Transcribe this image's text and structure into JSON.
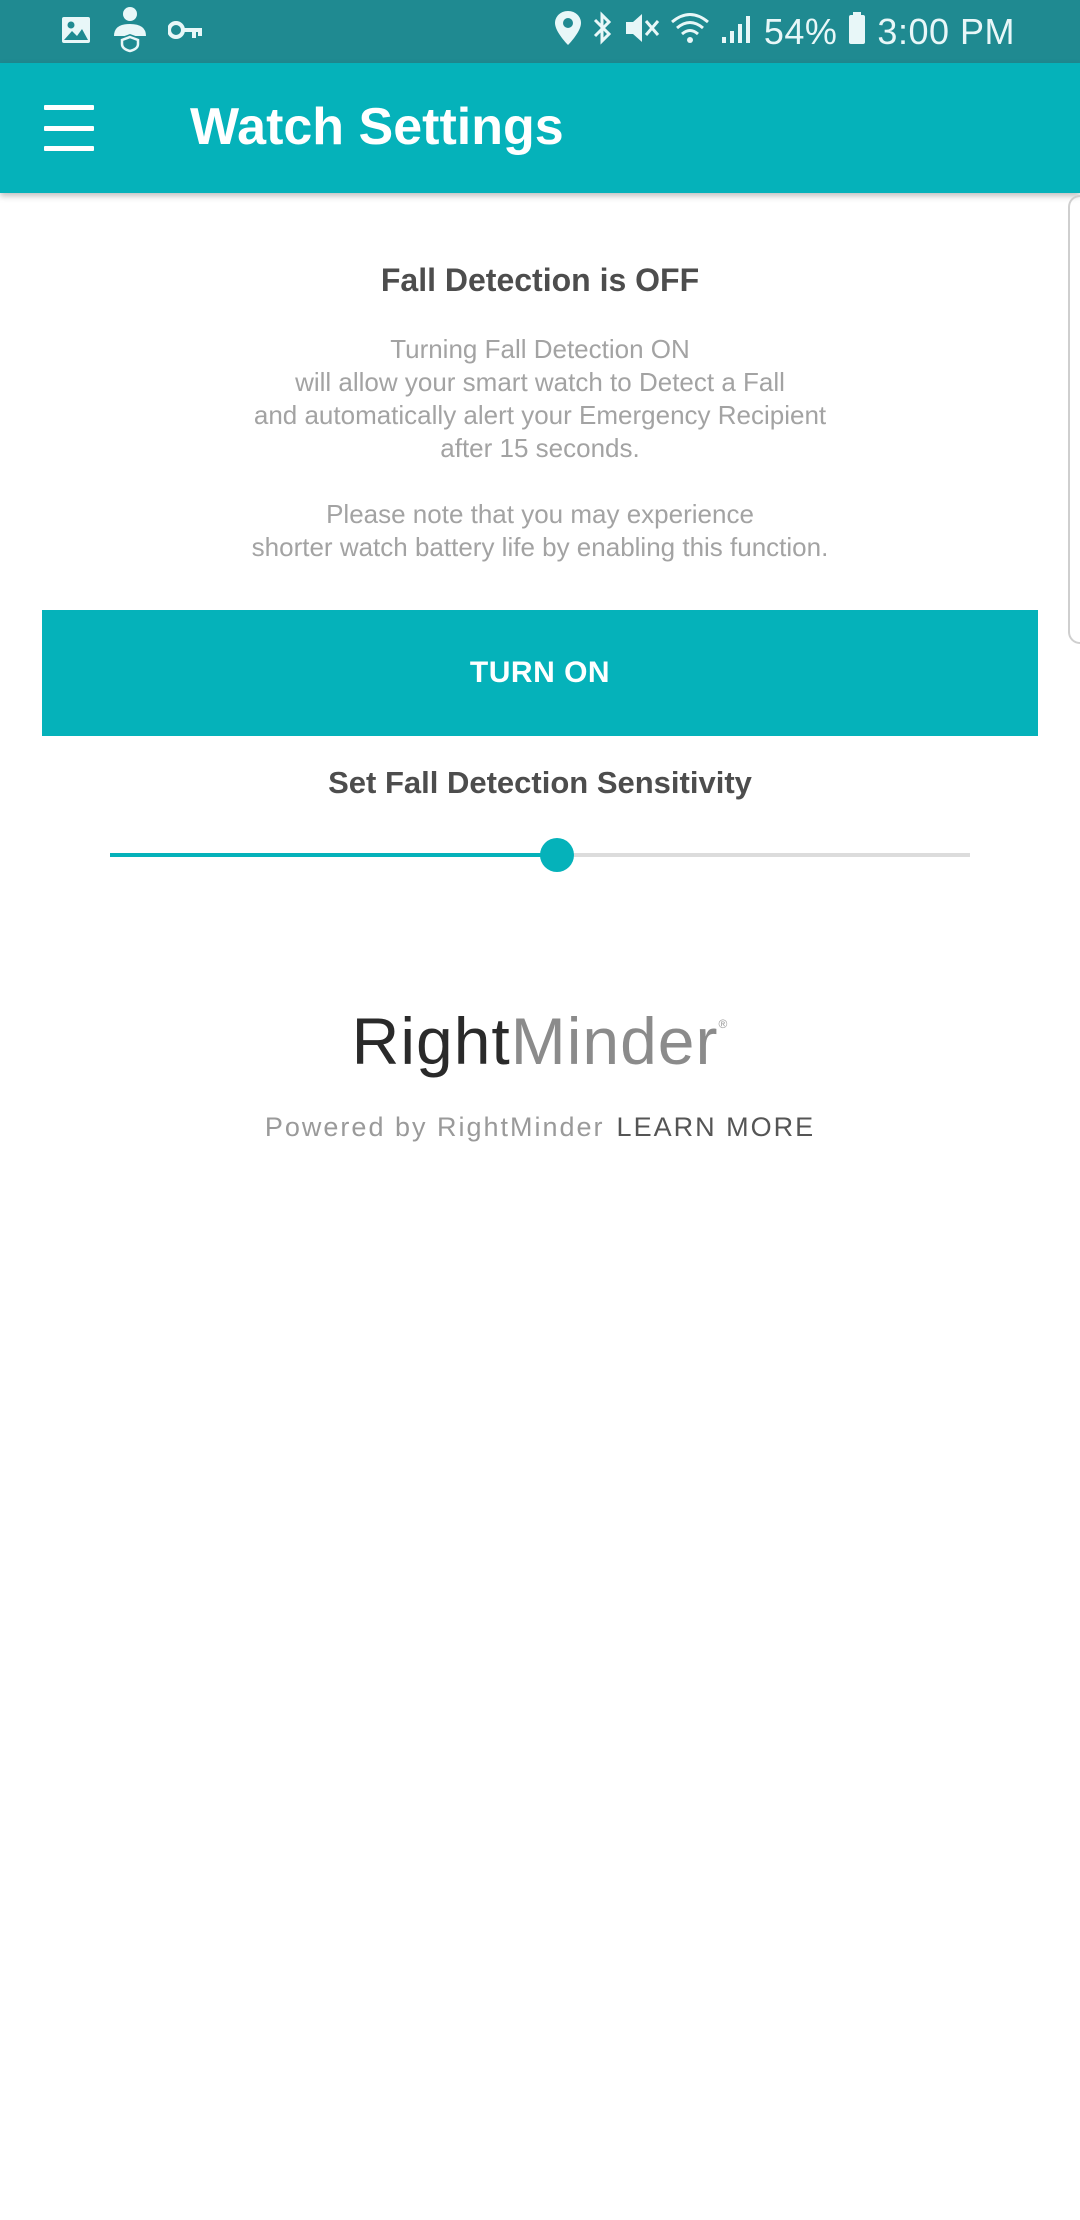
{
  "status_bar": {
    "left_icons": [
      "gallery-icon",
      "user-shield-icon",
      "key-icon"
    ],
    "right_icons": [
      "location-icon",
      "bluetooth-icon",
      "mute-icon",
      "wifi-icon",
      "signal-icon",
      "battery-icon"
    ],
    "battery": "54%",
    "time": "3:00 PM"
  },
  "app_bar": {
    "title": "Watch Settings",
    "menu_icon": "menu-icon"
  },
  "fall_detection": {
    "status_title": "Fall Detection is OFF",
    "description_lines": [
      "Turning Fall Detection ON",
      "will allow your smart watch to Detect a Fall",
      "and automatically alert your Emergency Recipient",
      "after 15 seconds."
    ],
    "note_lines": [
      "Please note that you may experience",
      "shorter watch battery life by enabling this function."
    ],
    "turn_on_label": "TURN ON"
  },
  "sensitivity": {
    "label": "Set Fall Detection Sensitivity",
    "value_fraction": 0.52
  },
  "branding": {
    "logo_part1": "Right",
    "logo_part2": "Minder",
    "powered_by": "Powered by RightMinder",
    "learn_more": "LEARN MORE"
  },
  "colors": {
    "status_bar": "#1f8a91",
    "accent": "#05b2ba",
    "title_text": "#4d4d4d",
    "muted_text": "#a3a3a3"
  }
}
